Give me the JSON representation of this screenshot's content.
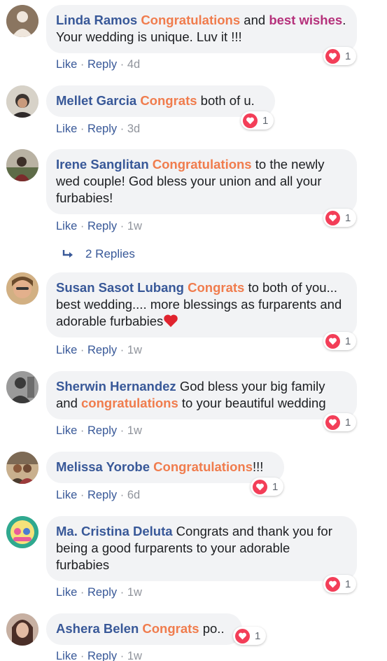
{
  "comments": [
    {
      "author": "Linda Ramos",
      "text_parts": [
        "Congratulations",
        " and ",
        "best wishes",
        ". Your wedding is unique. Luv it !!!"
      ],
      "like": "Like",
      "reply": "Reply",
      "sep": "·",
      "time": "4d",
      "reaction_count": "1",
      "avatar_colors": [
        "#8a7560",
        "#efe6dc"
      ]
    },
    {
      "author": "Mellet Garcia",
      "text_parts": [
        "Congrats",
        " both of u."
      ],
      "like": "Like",
      "reply": "Reply",
      "sep": "·",
      "time": "3d",
      "reaction_count": "1",
      "avatar_colors": [
        "#d7d2c8",
        "#3b3430"
      ]
    },
    {
      "author": "Irene Sanglitan",
      "text_parts": [
        "Congratulations",
        " to the newly wed couple! God bless your union and all your furbabies!"
      ],
      "like": "Like",
      "reply": "Reply",
      "sep": "·",
      "time": "1w",
      "reaction_count": "1",
      "replies_label": "2 Replies",
      "avatar_colors": [
        "#5e6c48",
        "#b9b2a3"
      ]
    },
    {
      "author": "Susan Sasot Lubang",
      "text_parts": [
        "Congrats",
        " to both of you... best wedding.... more blessings as furparents and adorable furbabies"
      ],
      "like": "Like",
      "reply": "Reply",
      "sep": "·",
      "time": "1w",
      "reaction_count": "1",
      "avatar_colors": [
        "#d2b083",
        "#6b4b2c"
      ]
    },
    {
      "author": "Sherwin Hernandez",
      "text_parts": [
        " God bless your big family and ",
        "congratulations",
        " to your beautiful wedding"
      ],
      "like": "Like",
      "reply": "Reply",
      "sep": "·",
      "time": "1w",
      "reaction_count": "1",
      "avatar_colors": [
        "#9a9a9a",
        "#3a3a3a"
      ]
    },
    {
      "author": "Melissa Yorobe",
      "text_parts": [
        "Congratulations",
        "!!!"
      ],
      "like": "Like",
      "reply": "Reply",
      "sep": "·",
      "time": "6d",
      "reaction_count": "1",
      "avatar_colors": [
        "#7d6a55",
        "#c9b08e"
      ]
    },
    {
      "author": "Ma. Cristina Deluta",
      "text_parts": [
        " Congrats and thank you for being a good furparents to your adorable furbabies"
      ],
      "like": "Like",
      "reply": "Reply",
      "sep": "·",
      "time": "1w",
      "reaction_count": "1",
      "avatar_colors": [
        "#2fa98f",
        "#e85c9a"
      ]
    },
    {
      "author": "Ashera Belen",
      "text_parts": [
        "Congrats",
        " po.."
      ],
      "like": "Like",
      "reply": "Reply",
      "sep": "·",
      "time": "1w",
      "reaction_count": "1",
      "avatar_colors": [
        "#c7b0a2",
        "#4a2e27"
      ]
    }
  ],
  "colors": {
    "author": "#385898",
    "highlight": "#f07c4d",
    "highlight_alt": "#b5317b",
    "bubble": "#f2f3f5",
    "reaction_heart": "#f33e58",
    "timestamp": "#90949c"
  },
  "icons": {
    "reaction": "love-reaction-icon",
    "reply_arrow": "reply-arrow-icon",
    "emoji": "red-heart-emoji"
  }
}
